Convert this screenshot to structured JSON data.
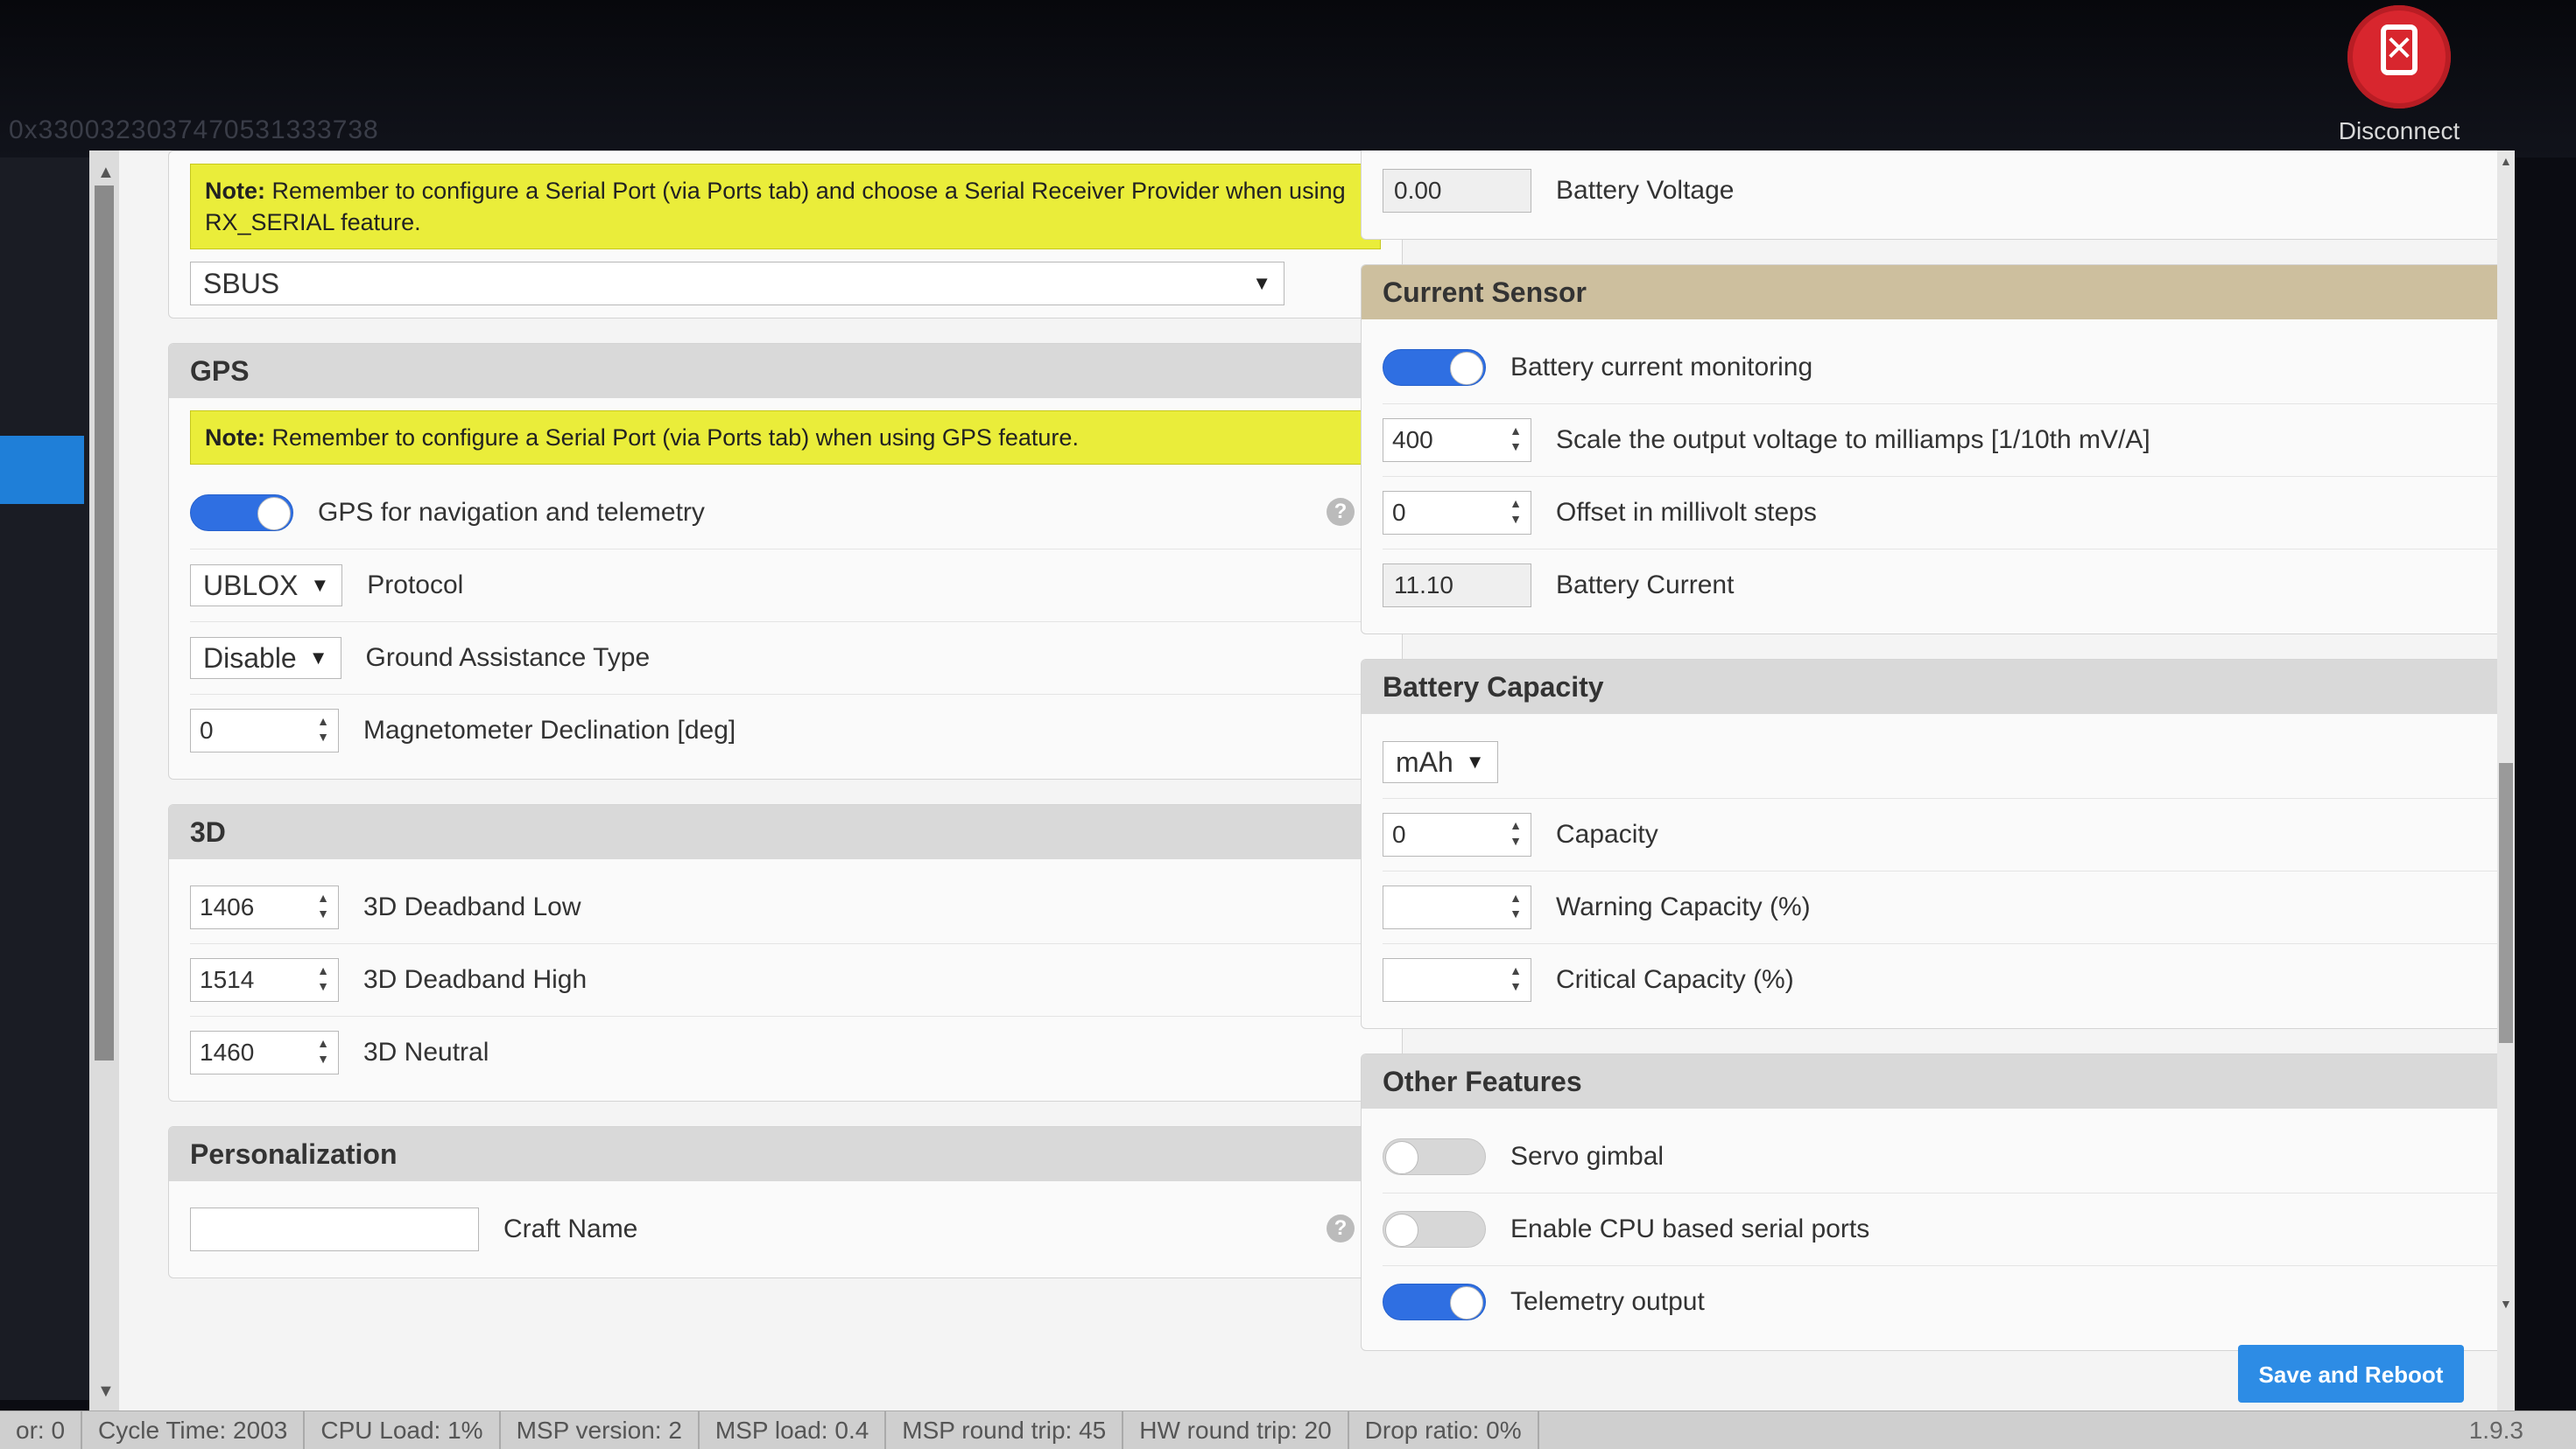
{
  "header": {
    "board_id": "0x3300323037470531333738",
    "disconnect_label": "Disconnect",
    "disconnect_icon": "usb-disconnect-icon"
  },
  "receiver": {
    "note_bold": "Note:",
    "note_text": "Remember to configure a Serial Port (via Ports tab) and choose a Serial Receiver Provider when using RX_SERIAL feature.",
    "provider_value": "SBUS"
  },
  "gps": {
    "title": "GPS",
    "note_bold": "Note:",
    "note_text": "Remember to configure a Serial Port (via Ports tab) when using GPS feature.",
    "toggle_label": "GPS for navigation and telemetry",
    "toggle_on": true,
    "protocol_value": "UBLOX",
    "protocol_label": "Protocol",
    "ground_assist_value": "Disable",
    "ground_assist_label": "Ground Assistance Type",
    "mag_decl_value": "0",
    "mag_decl_label": "Magnetometer Declination [deg]"
  },
  "three_d": {
    "title": "3D",
    "deadband_low_value": "1406",
    "deadband_low_label": "3D Deadband Low",
    "deadband_high_value": "1514",
    "deadband_high_label": "3D Deadband High",
    "neutral_value": "1460",
    "neutral_label": "3D Neutral"
  },
  "personalization": {
    "title": "Personalization",
    "craft_name_value": "",
    "craft_name_label": "Craft Name"
  },
  "voltage": {
    "battery_voltage_value": "0.00",
    "battery_voltage_label": "Battery Voltage"
  },
  "current_sensor": {
    "title": "Current Sensor",
    "monitoring_label": "Battery current monitoring",
    "monitoring_on": true,
    "scale_value": "400",
    "scale_label": "Scale the output voltage to milliamps [1/10th mV/A]",
    "offset_value": "0",
    "offset_label": "Offset in millivolt steps",
    "current_value": "11.10",
    "current_label": "Battery Current"
  },
  "battery_capacity": {
    "title": "Battery Capacity",
    "unit_value": "mAh",
    "capacity_value": "0",
    "capacity_label": "Capacity",
    "warning_value": "",
    "warning_label": "Warning Capacity (%)",
    "critical_value": "",
    "critical_label": "Critical Capacity (%)"
  },
  "other_features": {
    "title": "Other Features",
    "servo_gimbal_label": "Servo gimbal",
    "servo_gimbal_on": false,
    "cpu_serial_label": "Enable CPU based serial ports",
    "cpu_serial_on": false,
    "telemetry_label": "Telemetry output",
    "telemetry_on": true
  },
  "actions": {
    "save_reboot_label": "Save and Reboot"
  },
  "status": {
    "error_text": "or: 0",
    "cycle_time": "Cycle Time: 2003",
    "cpu_load": "CPU Load: 1%",
    "msp_version": "MSP version: 2",
    "msp_load": "MSP load: 0.4",
    "msp_round_trip": "MSP round trip: 45",
    "hw_round_trip": "HW round trip: 20",
    "drop_ratio": "Drop ratio: 0%",
    "version": "1.9.3"
  },
  "colors": {
    "accent_blue": "#2f6fe2",
    "note_yellow": "#eaed3a",
    "disconnect_red": "#d8262e",
    "save_button": "#2d8ce5"
  }
}
